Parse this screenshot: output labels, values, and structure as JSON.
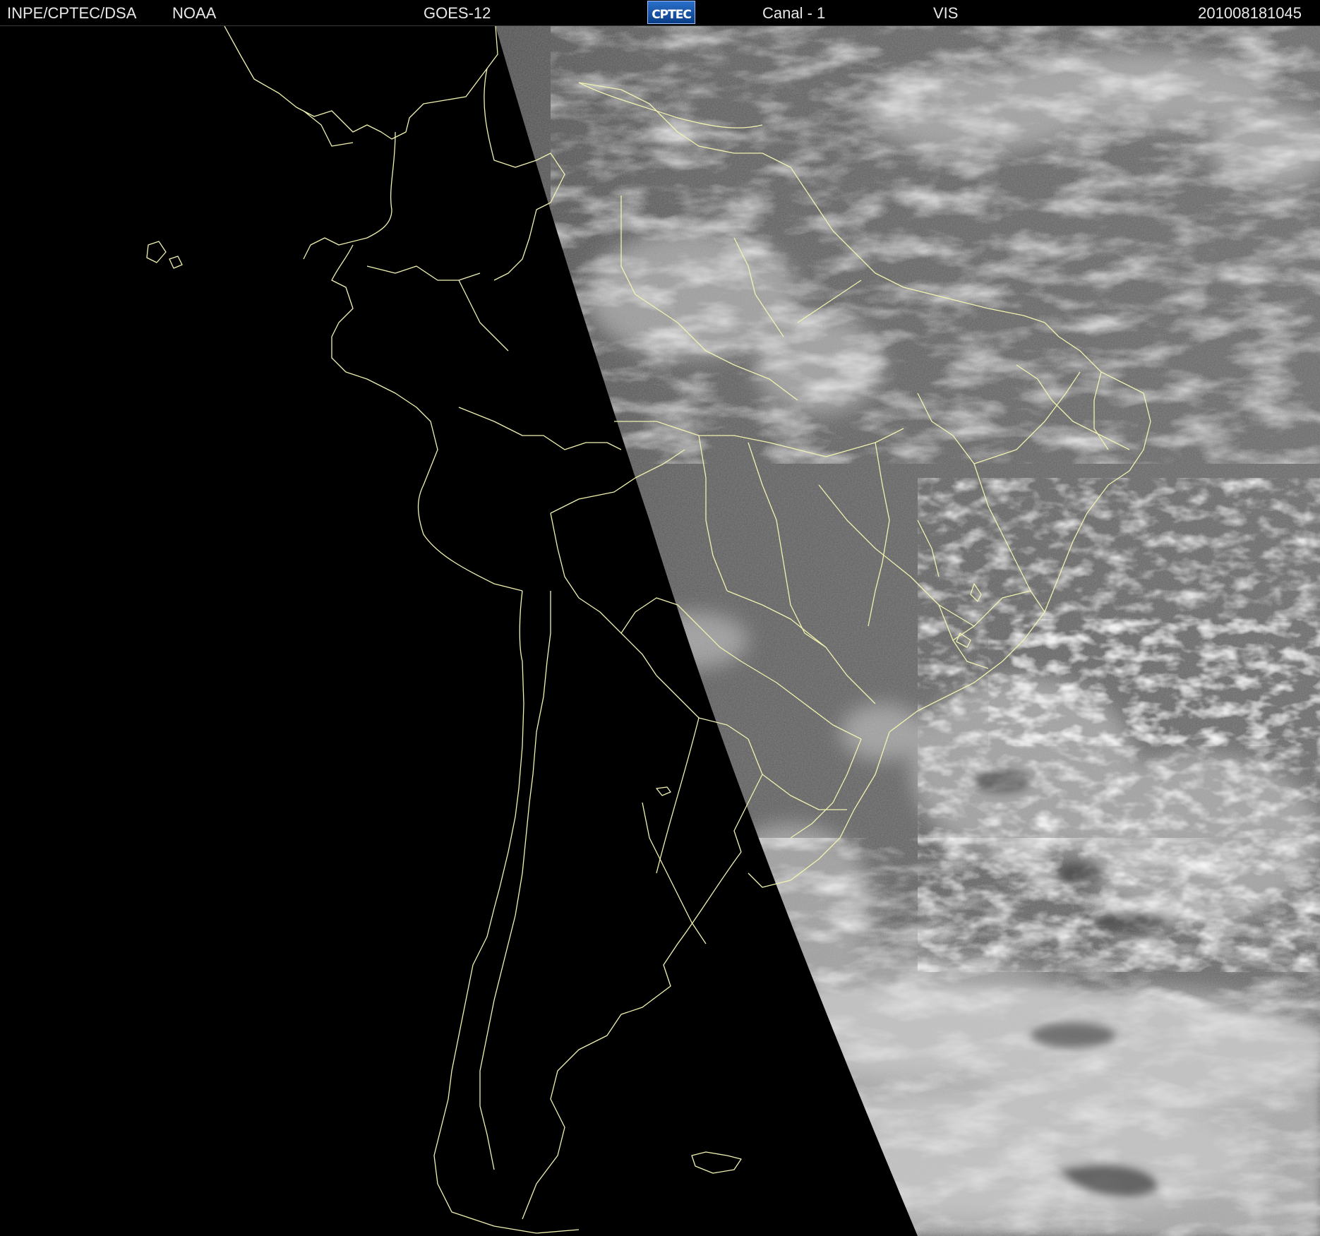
{
  "header": {
    "organization": "INPE/CPTEC/DSA",
    "source": "NOAA",
    "satellite": "GOES-12",
    "logo_text": "CPTEC",
    "channel": "Canal - 1",
    "band": "VIS",
    "timestamp": "201008181045"
  },
  "image": {
    "type": "visible satellite image",
    "border_line_color": "#f2f2b0",
    "night_side_color": "#000000",
    "day_side_color": "#6e6e6e",
    "cloud_color": "#e8e8e8"
  }
}
